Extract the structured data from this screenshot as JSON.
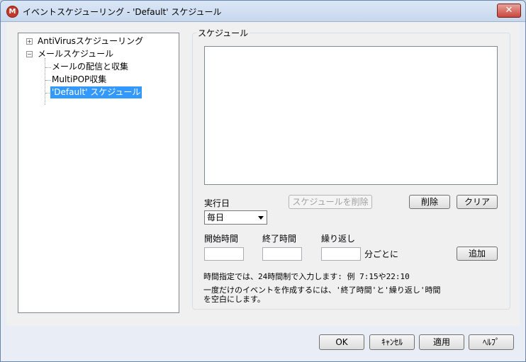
{
  "window": {
    "title": "イベントスケジューリング - 'Default' スケジュール",
    "app_icon_glyph": "M",
    "close_glyph": "✕"
  },
  "tree": {
    "expander_plus": "+",
    "expander_minus": "−",
    "antivirus": "AntiVirusスケジューリング",
    "mail_schedule": "メールスケジュール",
    "delivery": "メールの配信と収集",
    "multipop": "MultiPOP収集",
    "default": "'Default' スケジュール"
  },
  "schedule": {
    "group_title": "スケジュール",
    "run_day_label": "実行日",
    "run_day_value": "毎日",
    "delete_schedule_button": "スケジュールを削除",
    "delete_button": "削除",
    "clear_button": "クリア",
    "start_time_label": "開始時間",
    "end_time_label": "終了時間",
    "repeat_label": "繰り返し",
    "start_time_value": "",
    "end_time_value": "",
    "repeat_value": "",
    "minutes_label": "分ごとに",
    "add_button": "追加",
    "note1": "時間指定では、24時間制で入力します: 例 7:15や22:10",
    "note2": "一度だけのイベントを作成するには、'終了時間'と'繰り返し'時間",
    "note3": "を空白にします。"
  },
  "footer": {
    "ok": "OK",
    "cancel": "ｷｬﾝｾﾙ",
    "apply": "適用",
    "help": "ﾍﾙﾌﾟ"
  }
}
